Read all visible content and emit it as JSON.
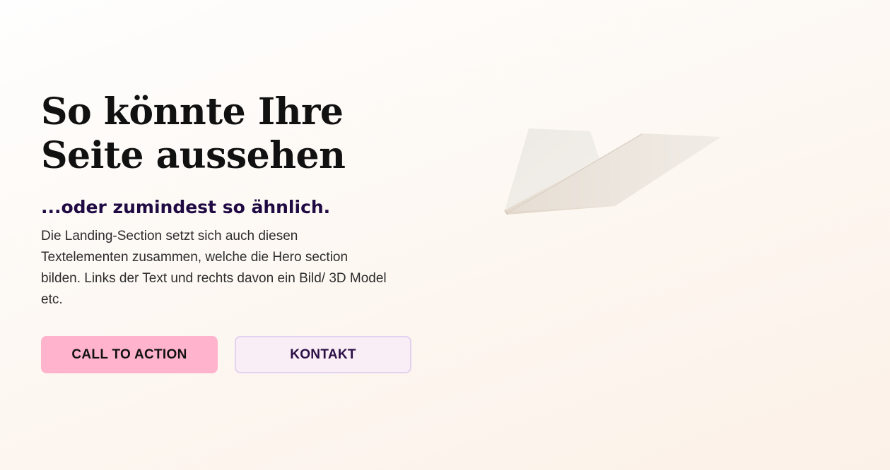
{
  "hero": {
    "headline_line1": "So könnte Ihre",
    "headline_line2": "Seite aussehen",
    "subheadline": "...oder zumindest so ähnlich.",
    "body": "Die Landing-Section setzt sich auch diesen Textelementen zusammen, welche die Hero section bilden. Links der Text und rechts davon ein Bild/ 3D Model etc."
  },
  "buttons": {
    "cta_label": "CALL TO ACTION",
    "contact_label": "KONTAKT"
  },
  "image": {
    "icon": "paper-plane-illustration"
  },
  "colors": {
    "cta_background": "#ffb3cd",
    "contact_background": "#f9edf6",
    "contact_border": "#e3d2ee",
    "subheadline": "#1f0a43",
    "headline": "#111111"
  }
}
